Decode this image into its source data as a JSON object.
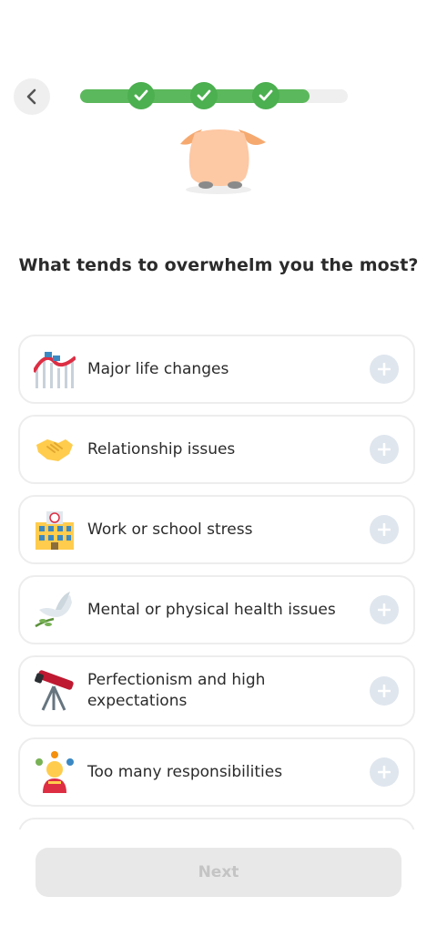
{
  "header": {
    "back_icon": "chevron-left-icon",
    "progress": {
      "completed_steps": 3,
      "total_steps": 4,
      "fill_fraction": 0.86
    },
    "colors": {
      "progress_fill": "#5cb85c",
      "check_bg": "#4caf50",
      "track": "#efefef"
    }
  },
  "question": "What tends to overwhelm you the most?",
  "options": [
    {
      "label": "Major life changes",
      "icon": "roller-coaster-icon"
    },
    {
      "label": "Relationship issues",
      "icon": "handshake-icon"
    },
    {
      "label": "Work or school stress",
      "icon": "office-building-icon"
    },
    {
      "label": "Mental or physical health issues",
      "icon": "dove-icon"
    },
    {
      "label": "Perfectionism and high expectations",
      "icon": "telescope-icon"
    },
    {
      "label": "Too many responsibilities",
      "icon": "juggling-person-icon"
    }
  ],
  "next_button": {
    "label": "Next",
    "enabled": false
  }
}
